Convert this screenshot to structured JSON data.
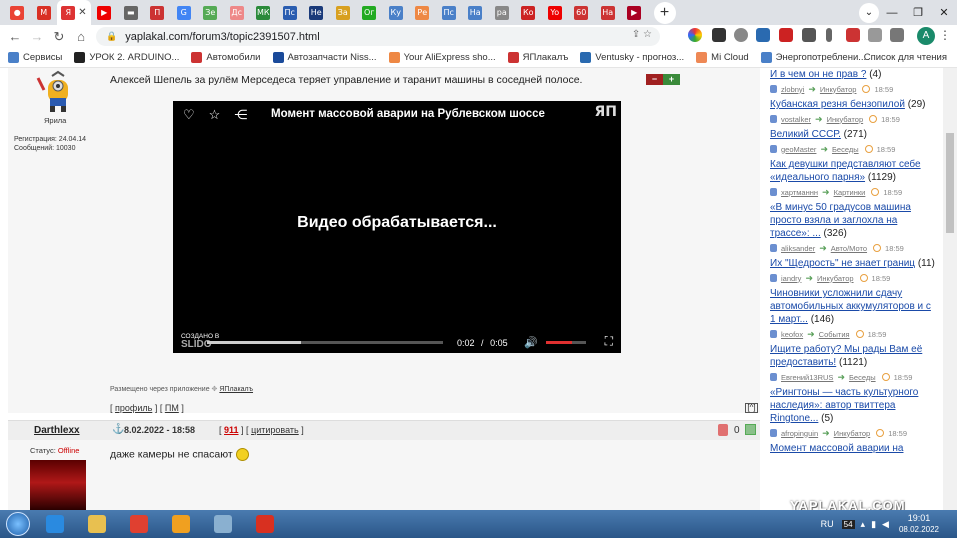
{
  "browser": {
    "tabs": [
      {
        "icon": "maps-icon",
        "color": "#ea4335",
        "glyph": "●"
      },
      {
        "icon": "gmail-icon",
        "color": "#d93025",
        "glyph": "M"
      },
      {
        "icon": "yaplakal-icon",
        "color": "#d33",
        "glyph": "Я",
        "active": true
      },
      {
        "icon": "youtube-icon",
        "color": "#e00",
        "glyph": "▶"
      },
      {
        "icon": "card-icon",
        "color": "#666",
        "glyph": "▬"
      },
      {
        "icon": "site-icon",
        "color": "#c33",
        "glyph": "П"
      },
      {
        "icon": "google-icon",
        "color": "#4285f4",
        "glyph": "G"
      },
      {
        "icon": "site-icon",
        "color": "#5a5",
        "glyph": "Зе"
      },
      {
        "icon": "site-icon",
        "color": "#e88",
        "glyph": "Дс"
      },
      {
        "icon": "mk-icon",
        "color": "#2a8a3a",
        "glyph": "МК"
      },
      {
        "icon": "site-icon",
        "color": "#2a5db0",
        "glyph": "Пс"
      },
      {
        "icon": "site-icon",
        "color": "#1a3a7a",
        "glyph": "Не"
      },
      {
        "icon": "site-icon",
        "color": "#d8a020",
        "glyph": "За"
      },
      {
        "icon": "site-icon",
        "color": "#2a2",
        "glyph": "Ог"
      },
      {
        "icon": "site-icon",
        "color": "#4a80c8",
        "glyph": "Ку"
      },
      {
        "icon": "site-icon",
        "color": "#e84",
        "glyph": "Ре"
      },
      {
        "icon": "site-icon",
        "color": "#4a80c8",
        "glyph": "Пс"
      },
      {
        "icon": "site-icon",
        "color": "#4a80c8",
        "glyph": "На"
      },
      {
        "icon": "google-icon",
        "color": "#888",
        "glyph": "ра"
      },
      {
        "icon": "site-icon",
        "color": "#c22",
        "glyph": "Ко"
      },
      {
        "icon": "youtube-icon",
        "color": "#e00",
        "glyph": "Yo"
      },
      {
        "icon": "site-icon",
        "color": "#c33",
        "glyph": "60"
      },
      {
        "icon": "site-icon",
        "color": "#c33",
        "glyph": "На"
      },
      {
        "icon": "site-icon",
        "color": "#a02",
        "glyph": "▶"
      }
    ],
    "url": "yaplakal.com/forum3/topic2391507.html",
    "avatar_letter": "A",
    "bookmarks": [
      {
        "label": "Сервисы",
        "color": "#4a80c8"
      },
      {
        "label": "УРОК 2. ARDUINO...",
        "color": "#222"
      },
      {
        "label": "Автомобили",
        "color": "#c33"
      },
      {
        "label": "Автозапчасти Niss...",
        "color": "#1a4a9a"
      },
      {
        "label": "Your AliExpress sho...",
        "color": "#e84"
      },
      {
        "label": "ЯПлакалъ",
        "color": "#c33"
      },
      {
        "label": "Ventusky - прогноз...",
        "color": "#2a6ab0"
      },
      {
        "label": "Mi Cloud",
        "color": "#e85"
      },
      {
        "label": "Энергопотреблени...",
        "color": "#4a80c8"
      }
    ],
    "reading_list": "Список для чтения"
  },
  "post1": {
    "rank": "Ярила",
    "registration": "Регистрация: 24.04.14",
    "messages": "Сообщений: 10030",
    "text": "Алексей Шепель за рулём Мерседеса теряет управление и таранит машины в соседней полосе.",
    "vote_minus": "−",
    "vote_plus": "+",
    "video": {
      "title": "Момент массовой аварии на Рублевском шоссе",
      "logo": "ЯП",
      "status": "Видео обрабатывается...",
      "created": "СОЗДАНО В",
      "created_brand": "SLIDO",
      "time_current": "0:02",
      "time_sep": "/",
      "time_total": "0:05",
      "progress": 0.4,
      "volume": 0.65
    },
    "placed_via_prefix": "Размещено через приложение",
    "placed_via_app": "ЯПлакалъ",
    "links": {
      "open": "[",
      "profile": "профиль",
      "mid": "] [",
      "pm": "ПМ",
      "close": "]"
    },
    "top_label": "[^]"
  },
  "post2": {
    "author": "Darthlexx",
    "anchor": "⚓",
    "date": "8.02.2022 - 18:58",
    "num": "911",
    "cite": "цитировать",
    "rating": "0",
    "status_label": "Статус:",
    "status_value": "Offline",
    "text": "даже камеры не спасают"
  },
  "sidebar": {
    "topics": [
      {
        "title": "И в чем он не прав ?",
        "count": "(4)",
        "author": "zlobnyi",
        "section": "Инкубатор",
        "time": "18:59"
      },
      {
        "title": "Кубанская резня бензопилой",
        "count": "(29)",
        "author": "vostalker",
        "section": "Инкубатор",
        "time": "18:59"
      },
      {
        "title": "Великий СССР.",
        "count": "(271)",
        "author": "geoMaster",
        "section": "Беседы",
        "time": "18:59"
      },
      {
        "title": "Как девушки представляют себе «идеального парня»",
        "count": "(1129)",
        "author": "хартманнн",
        "section": "Картинки",
        "time": "18:59"
      },
      {
        "title": "«В минус 50 градусов машина просто взяла и заглохла на трассе»: ...",
        "count": "(326)",
        "author": "aliksander",
        "section": "Авто/Мото",
        "time": "18:59"
      },
      {
        "title": "Их \"Щедрость\" не знает границ",
        "count": "(11)",
        "author": "iandry",
        "section": "Инкубатор",
        "time": "18:59"
      },
      {
        "title": "Чиновники усложнили сдачу автомобильных аккумуляторов и с 1 март...",
        "count": "(146)",
        "author": "keofox",
        "section": "События",
        "time": "18:59"
      },
      {
        "title": "Ищите работу? Мы рады Вам её предоставить!",
        "count": "(1121)",
        "author": "Евгений13RUS",
        "section": "Беседы",
        "time": "18:59"
      },
      {
        "title": "«Рингтоны — часть культурного наследия»: автор твиттера Ringtone...",
        "count": "(5)",
        "author": "afropinguin",
        "section": "Инкубатор",
        "time": "18:59"
      },
      {
        "title": "Момент массовой аварии на",
        "count": "",
        "author": "",
        "section": "",
        "time": ""
      }
    ]
  },
  "watermark": "YAPLAKAL.COM",
  "taskbar": {
    "apps": [
      {
        "icon": "ie-icon",
        "color": "#2a8ae0"
      },
      {
        "icon": "explorer-icon",
        "color": "#e8c050"
      },
      {
        "icon": "chrome-icon",
        "color": "#e04030"
      },
      {
        "icon": "media-player-icon",
        "color": "#f0a020"
      },
      {
        "icon": "calculator-icon",
        "color": "#8ab0d0"
      },
      {
        "icon": "slides-app-icon",
        "color": "#d83020"
      }
    ],
    "lang": "RU",
    "badge": "54",
    "time": "19:01",
    "date": "08.02.2022"
  }
}
